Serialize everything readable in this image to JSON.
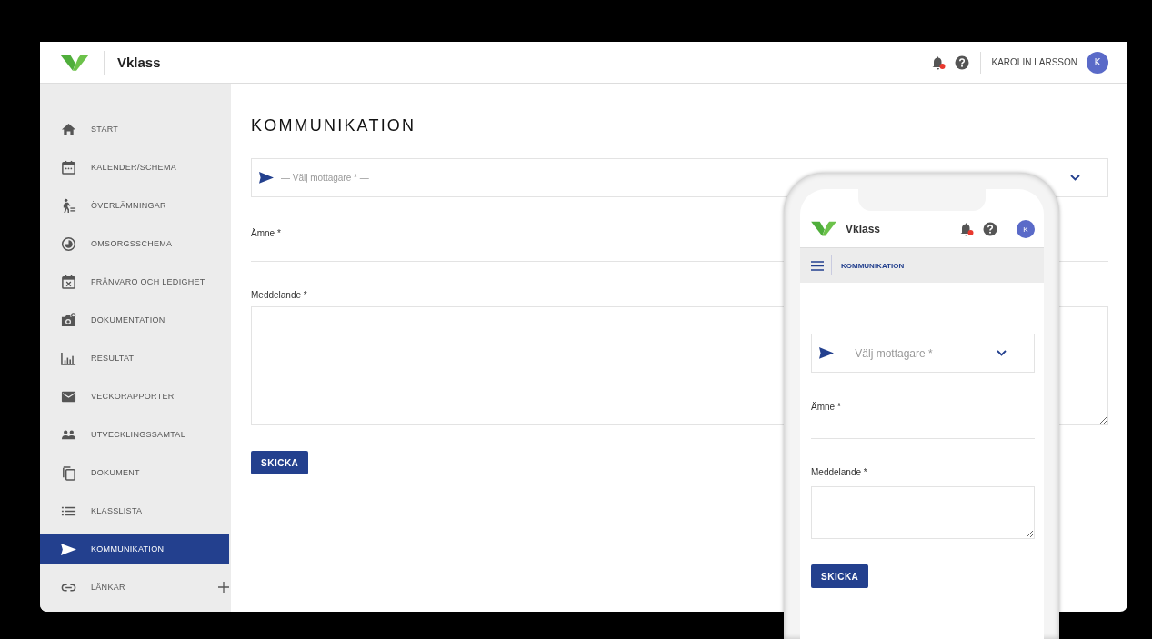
{
  "header": {
    "logo_text": "Vklass",
    "notifications_unread": true,
    "user_name": "KAROLIN LARSSON",
    "avatar_initial": "K"
  },
  "sidebar": {
    "items": [
      {
        "label": "START",
        "selected": false
      },
      {
        "label": "KALENDER/SCHEMA",
        "selected": false
      },
      {
        "label": "ÖVERLÄMNINGAR",
        "selected": false
      },
      {
        "label": "OMSORGSSCHEMA",
        "selected": false
      },
      {
        "label": "FRÅNVARO OCH LEDIGHET",
        "selected": false
      },
      {
        "label": "DOKUMENTATION",
        "selected": false
      },
      {
        "label": "RESULTAT",
        "selected": false
      },
      {
        "label": "VECKORAPPORTER",
        "selected": false
      },
      {
        "label": "UTVECKLINGSSAMTAL",
        "selected": false
      },
      {
        "label": "DOKUMENT",
        "selected": false
      },
      {
        "label": "KLASSLISTA",
        "selected": false
      },
      {
        "label": "KOMMUNIKATION",
        "selected": true
      },
      {
        "label": "LÄNKAR",
        "selected": false
      }
    ]
  },
  "page": {
    "title": "KOMMUNIKATION",
    "recipient": {
      "placeholder": "— Välj mottagare * —"
    },
    "subject": {
      "label": "Ämne *"
    },
    "message": {
      "label": "Meddelande *"
    },
    "send_button": "SKICKA"
  },
  "mobile": {
    "logo_text": "Vklass",
    "notifications_unread": true,
    "avatar_initial": "K",
    "section_title": "KOMMUNIKATION",
    "recipient": {
      "placeholder": "— Välj mottagare * –"
    },
    "subject": {
      "label": "Ämne *"
    },
    "message": {
      "label": "Meddelande *"
    },
    "send_button": "SKICKA"
  }
}
